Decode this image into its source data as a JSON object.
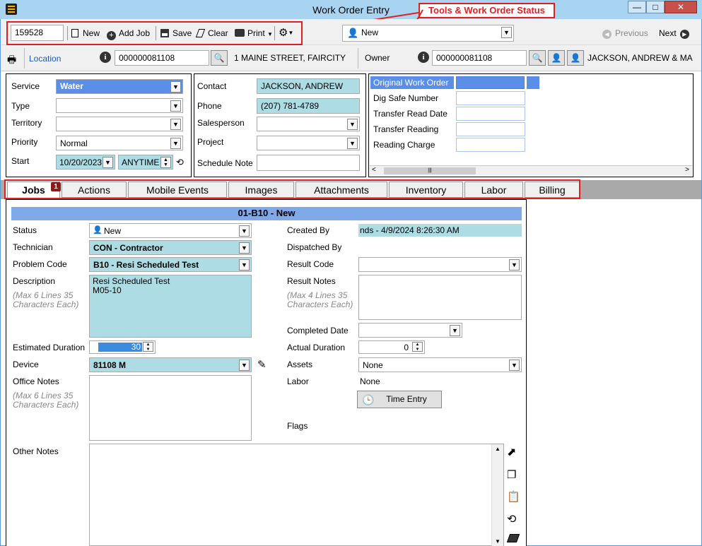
{
  "window": {
    "title": "Work Order Entry",
    "min": "—",
    "max": "□",
    "close": "✕"
  },
  "callout": "Tools & Work Order Status",
  "toolbar": {
    "wo_number": "159528",
    "new": "New",
    "add_job": "Add Job",
    "save": "Save",
    "clear": "Clear",
    "print": "Print",
    "status": "New",
    "previous": "Previous",
    "next": "Next"
  },
  "location": {
    "label": "Location",
    "id": "000000081108",
    "address": "1 MAINE STREET, FAIRCITY"
  },
  "owner": {
    "label": "Owner",
    "id": "000000081108",
    "name": "JACKSON, ANDREW & MA"
  },
  "left_form": {
    "service_label": "Service",
    "service": "Water",
    "type_label": "Type",
    "territory_label": "Territory",
    "priority_label": "Priority",
    "priority": "Normal",
    "start_label": "Start",
    "start_date": "10/20/2023",
    "start_time": "ANYTIME"
  },
  "mid_form": {
    "contact_label": "Contact",
    "contact": "JACKSON, ANDREW",
    "phone_label": "Phone",
    "phone": "(207) 781-4789",
    "salesperson_label": "Salesperson",
    "project_label": "Project",
    "schedule_note_label": "Schedule Note"
  },
  "right_form": {
    "original_wo": "Original Work Order #",
    "dig_safe": "Dig Safe Number",
    "transfer_read_date": "Transfer Read Date",
    "transfer_reading": "Transfer Reading",
    "reading_charge": "Reading Charge"
  },
  "tabs": [
    {
      "label": "Jobs",
      "badge": "1"
    },
    {
      "label": "Actions"
    },
    {
      "label": "Mobile Events"
    },
    {
      "label": "Images"
    },
    {
      "label": "Attachments"
    },
    {
      "label": "Inventory"
    },
    {
      "label": "Labor"
    },
    {
      "label": "Billing"
    }
  ],
  "job": {
    "header": "01-B10 - New",
    "status_label": "Status",
    "status": "New",
    "technician_label": "Technician",
    "technician": "CON - Contractor",
    "problem_label": "Problem Code",
    "problem": "B10 - Resi Scheduled Test",
    "description_label": "Description",
    "description_hint": "(Max 6 Lines 35 Characters Each)",
    "description_line1": "Resi Scheduled Test",
    "description_line2": "M05-10",
    "est_duration_label": "Estimated Duration",
    "est_duration": "30",
    "device_label": "Device",
    "device": "81108 M",
    "office_notes_label": "Office Notes",
    "office_notes_hint": "(Max 6 Lines 35 Characters Each)",
    "other_notes_label": "Other Notes",
    "created_by_label": "Created By",
    "created_by": "nds - 4/9/2024 8:26:30 AM",
    "dispatched_by_label": "Dispatched By",
    "result_code_label": "Result Code",
    "result_notes_label": "Result Notes",
    "result_notes_hint": "(Max 4 Lines 35 Characters Each)",
    "completed_date_label": "Completed Date",
    "actual_duration_label": "Actual Duration",
    "actual_duration": "0",
    "assets_label": "Assets",
    "assets": "None",
    "labor_label": "Labor",
    "labor": "None",
    "time_entry": "Time Entry",
    "flags_label": "Flags"
  },
  "colors": {
    "accent": "#5b8ee6",
    "teal": "#aedce4",
    "header_band": "#7fa9e8",
    "callout": "#e02020"
  }
}
